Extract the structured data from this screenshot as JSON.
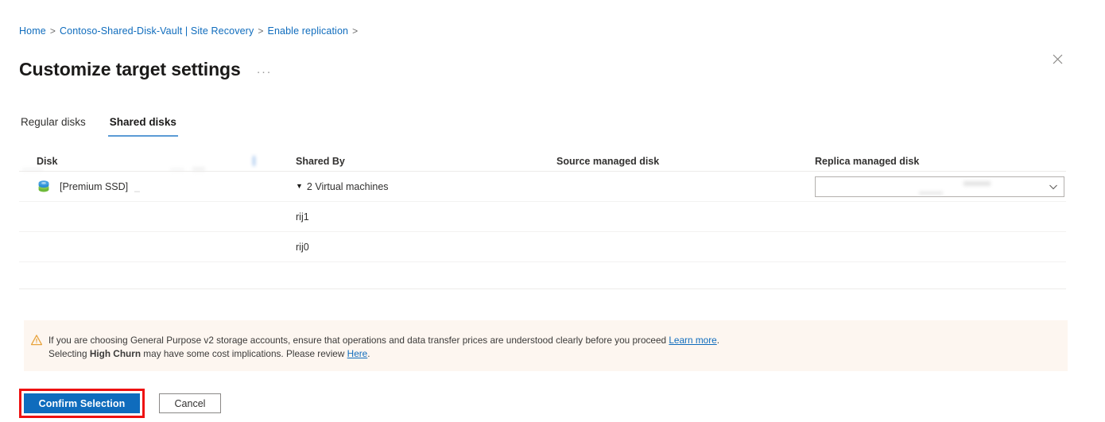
{
  "breadcrumb": {
    "separator": ">",
    "items": [
      {
        "label": "Home"
      },
      {
        "label": "Contoso-Shared-Disk-Vault | Site Recovery"
      },
      {
        "label": "Enable replication"
      }
    ],
    "trailing_separator": ">"
  },
  "header": {
    "title": "Customize target settings",
    "more_label": "···",
    "close_icon": "close-icon"
  },
  "tabs": [
    {
      "label": "Regular disks",
      "active": false
    },
    {
      "label": "Shared disks",
      "active": true
    }
  ],
  "table": {
    "columns": [
      {
        "key": "disk",
        "label": "Disk"
      },
      {
        "key": "shared_by",
        "label": "Shared By"
      },
      {
        "key": "source_managed_disk",
        "label": "Source managed disk"
      },
      {
        "key": "replica_managed_disk",
        "label": "Replica managed disk"
      }
    ],
    "rows": [
      {
        "type": "disk",
        "icon": "managed-disk-icon",
        "disk": "[Premium SSD]",
        "disk_suffix": "_",
        "shared_by": "2 Virtual machines",
        "expanded": true,
        "caret": "▼",
        "source_managed_disk": "",
        "replica_managed_disk": ""
      },
      {
        "type": "vm",
        "disk": "",
        "shared_by": "rij1",
        "source_managed_disk": "",
        "replica_managed_disk": ""
      },
      {
        "type": "vm",
        "disk": "",
        "shared_by": "rij0",
        "source_managed_disk": "",
        "replica_managed_disk": ""
      }
    ]
  },
  "warning": {
    "icon": "warning-triangle-icon",
    "line1_before": "If you are choosing General Purpose v2 storage accounts, ensure that operations and data transfer prices are understood clearly before you proceed ",
    "line1_link": "Learn more",
    "line1_after": ".",
    "line2_before": "Selecting ",
    "line2_bold": "High Churn",
    "line2_middle": " may have some cost implications. Please review ",
    "line2_link": "Here",
    "line2_after": "."
  },
  "footer": {
    "confirm_label": "Confirm Selection",
    "cancel_label": "Cancel"
  },
  "colors": {
    "accent": "#0f6cbd",
    "tab_underline": "#5b9bd5",
    "warning_bg": "#fdf6f0",
    "warning_icon": "#e8a33d",
    "highlight_box": "#ee1111",
    "link": "#0f6cbd"
  }
}
